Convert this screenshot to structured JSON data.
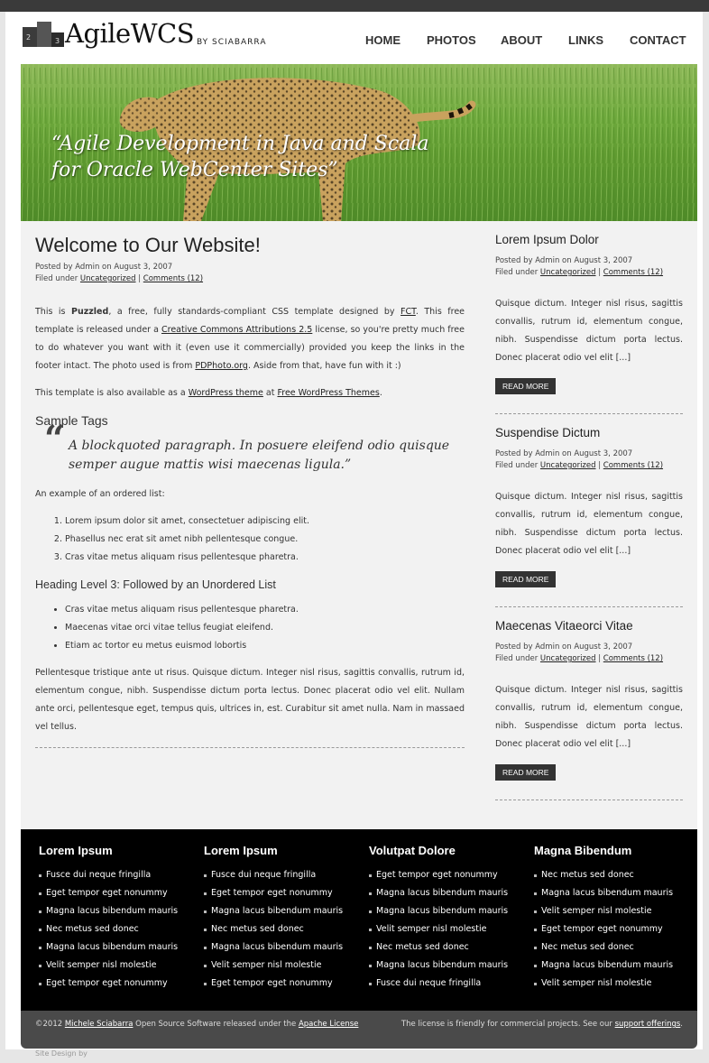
{
  "header": {
    "logo_text": "AgileWCS",
    "logo_by": "BY  SCIABARRA",
    "nav": [
      "HOME",
      "PHOTOS",
      "ABOUT",
      "LINKS",
      "CONTACT"
    ]
  },
  "hero": {
    "tagline_line1": "“Agile Development in Java and Scala",
    "tagline_line2": "for Oracle WebCenter Sites”"
  },
  "main": {
    "title": "Welcome to Our Website!",
    "posted_by": "Posted by Admin on August 3, 2007",
    "filed_prefix": "Filed under ",
    "category": "Uncategorized",
    "comments": "Comments (12)",
    "intro": {
      "p1_a": "This is ",
      "p1_b": "Puzzled",
      "p1_c": ", a free, fully standards-compliant CSS template designed by ",
      "p1_link1": "FCT",
      "p1_d": ". This free template is released under a ",
      "p1_link2": "Creative Commons Attributions 2.5",
      "p1_e": " license, so you're pretty much free to do whatever you want with it (even use it commercially) provided you keep the links in the footer intact. The photo used is from ",
      "p1_link3": "PDPhoto.org",
      "p1_f": ". Aside from that, have fun with it :)"
    },
    "p2_a": "This template is also available as a ",
    "p2_link1": "WordPress theme",
    "p2_b": " at ",
    "p2_link2": "Free WordPress Themes",
    "p2_c": ".",
    "sample_tags": "Sample Tags",
    "blockquote": "A blockquoted paragraph. In posuere eleifend odio quisque semper augue mattis wisi maecenas ligula.”",
    "ordered_intro": "An example of an ordered list:",
    "ordered": [
      "Lorem ipsum dolor sit amet, consectetuer adipiscing elit.",
      "Phasellus nec erat sit amet nibh pellentesque congue.",
      "Cras vitae metus aliquam risus pellentesque pharetra."
    ],
    "heading3": "Heading Level 3: Followed by an Unordered List",
    "unordered": [
      "Cras vitae metus aliquam risus pellentesque pharetra.",
      "Maecenas vitae orci vitae tellus feugiat eleifend.",
      "Etiam ac tortor eu metus euismod lobortis"
    ],
    "closing": "Pellentesque tristique ante ut risus. Quisque dictum. Integer nisl risus, sagittis convallis, rutrum id, elementum congue, nibh. Suspendisse dictum porta lectus. Donec placerat odio vel elit. Nullam ante orci, pellentesque eget, tempus quis, ultrices in, est. Curabitur sit amet nulla. Nam in massaed vel tellus."
  },
  "sidebar": {
    "posts": [
      {
        "title": "Lorem Ipsum Dolor",
        "posted_by": "Posted by Admin on August 3, 2007",
        "filed_prefix": "Filed under ",
        "category": "Uncategorized",
        "comments": "Comments (12)",
        "text": "Quisque dictum. Integer nisl risus, sagittis convallis, rutrum id, elementum congue, nibh. Suspendisse dictum porta lectus. Donec placerat odio vel elit [...]",
        "read_more": "READ MORE"
      },
      {
        "title": "Suspendise Dictum",
        "posted_by": "Posted by Admin on August 3, 2007",
        "filed_prefix": "Filed under ",
        "category": "Uncategorized",
        "comments": "Comments (12)",
        "text": "Quisque dictum. Integer nisl risus, sagittis convallis, rutrum id, elementum congue, nibh. Suspendisse dictum porta lectus. Donec placerat odio vel elit [...]",
        "read_more": "READ MORE"
      },
      {
        "title": "Maecenas Vitaeorci Vitae",
        "posted_by": "Posted by Admin on August 3, 2007",
        "filed_prefix": "Filed under ",
        "category": "Uncategorized",
        "comments": "Comments (12)",
        "text": "Quisque dictum. Integer nisl risus, sagittis convallis, rutrum id, elementum congue, nibh. Suspendisse dictum porta lectus. Donec placerat odio vel elit [...]",
        "read_more": "READ MORE"
      }
    ]
  },
  "footer": {
    "columns": [
      {
        "title": "Lorem Ipsum",
        "items": [
          "Fusce dui neque fringilla",
          "Eget tempor eget nonummy",
          "Magna lacus bibendum mauris",
          "Nec metus sed donec",
          "Magna lacus bibendum mauris",
          "Velit semper nisl molestie",
          "Eget tempor eget nonummy"
        ]
      },
      {
        "title": "Lorem Ipsum",
        "items": [
          "Fusce dui neque fringilla",
          "Eget tempor eget nonummy",
          "Magna lacus bibendum mauris",
          "Nec metus sed donec",
          "Magna lacus bibendum mauris",
          "Velit semper nisl molestie",
          "Eget tempor eget nonummy"
        ]
      },
      {
        "title": "Volutpat Dolore",
        "items": [
          "Eget tempor eget nonummy",
          "Magna lacus bibendum mauris",
          "Magna lacus bibendum mauris",
          "Velit semper nisl molestie",
          "Nec metus sed donec",
          "Magna lacus bibendum mauris",
          "Fusce dui neque fringilla"
        ]
      },
      {
        "title": "Magna Bibendum",
        "items": [
          "Nec metus sed donec",
          "Magna lacus bibendum mauris",
          "Velit semper nisl molestie",
          "Eget tempor eget nonummy",
          "Nec metus sed donec",
          "Magna lacus bibendum mauris",
          "Velit semper nisl molestie"
        ]
      }
    ]
  },
  "bottom": {
    "copyright_prefix": "©2012 ",
    "author": "Michele Sciabarra",
    "mid": " Open Source Software released under the ",
    "license": "Apache License",
    "right_text": "The license is friendly for commercial projects. See our ",
    "support": "support offerings",
    "right_end": ".",
    "site_design": "Site Design by"
  }
}
